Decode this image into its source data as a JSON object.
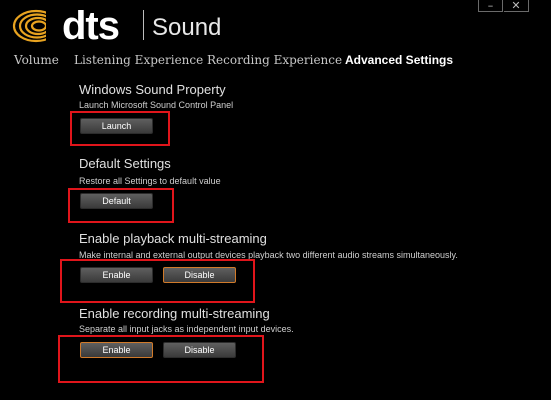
{
  "window": {
    "brand": "dts",
    "product": "Sound",
    "min_glyph": "–",
    "close_glyph": "✕"
  },
  "tabs": [
    {
      "label": "Volume",
      "active": false
    },
    {
      "label": "Listening Experience",
      "active": false
    },
    {
      "label": "Recording Experience",
      "active": false
    },
    {
      "label": "Advanced Settings",
      "active": true
    }
  ],
  "sections": {
    "windows_sound": {
      "title": "Windows Sound Property",
      "desc": "Launch Microsoft Sound Control Panel",
      "button": "Launch"
    },
    "defaults": {
      "title": "Default Settings",
      "desc": "Restore all Settings to default value",
      "button": "Default"
    },
    "playback": {
      "title": "Enable playback multi-streaming",
      "desc": "Make internal and external output devices playback two different audio streams simultaneously.",
      "enable": "Enable",
      "disable": "Disable",
      "selected": "Disable"
    },
    "recording": {
      "title": "Enable recording multi-streaming",
      "desc": "Separate all input jacks as independent input devices.",
      "enable": "Enable",
      "disable": "Disable",
      "selected": "Enable"
    }
  },
  "colors": {
    "background": "#000000",
    "highlight": "#e0151b",
    "selected_border": "#d07a2a",
    "logo_gold": "#e8a320"
  },
  "icons": {
    "logo": "dts-swirl-logo"
  }
}
